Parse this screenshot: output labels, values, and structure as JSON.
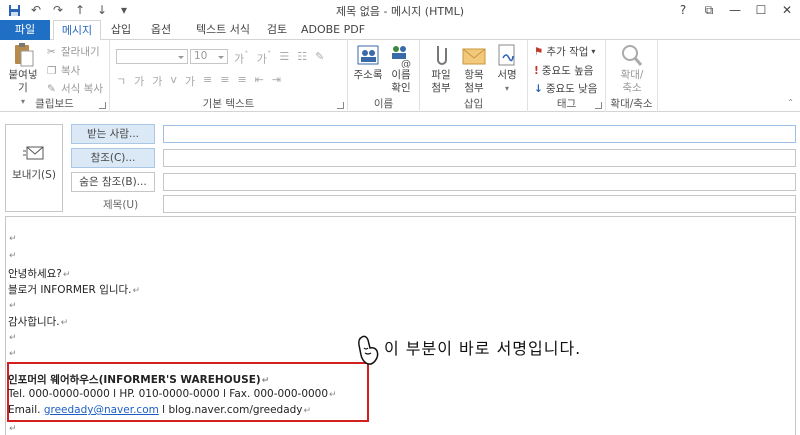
{
  "window": {
    "title": "제목 없음 - 메시지 (HTML)",
    "help": "?",
    "restore": "⧉",
    "minimize": "—",
    "maximize": "☐",
    "close": "✕"
  },
  "tabs": [
    {
      "label": "파일"
    },
    {
      "label": "메시지"
    },
    {
      "label": "삽입"
    },
    {
      "label": "옵션"
    },
    {
      "label": "텍스트 서식"
    },
    {
      "label": "검토"
    },
    {
      "label": "ADOBE PDF"
    }
  ],
  "ribbon": {
    "clipboard": {
      "label": "클립보드",
      "paste": "붙여넣기",
      "cut": "잘라내기",
      "copy": "복사",
      "format_painter": "서식 복사"
    },
    "basic_text": {
      "label": "기본 텍스트",
      "font_size": "10"
    },
    "names": {
      "label": "이름",
      "address_book": "주소록",
      "check_names_1": "이름",
      "check_names_2": "확인"
    },
    "insert": {
      "label": "삽입",
      "attach_file_1": "파일",
      "attach_file_2": "첨부",
      "attach_item_1": "항목",
      "attach_item_2": "첨부",
      "signature": "서명"
    },
    "tags": {
      "label": "태그",
      "follow_up": "추가 작업",
      "high_importance": "중요도 높음",
      "low_importance": "중요도 낮음"
    },
    "zoom": {
      "label": "확대/축소",
      "zoom_1": "확대/",
      "zoom_2": "축소"
    }
  },
  "header": {
    "send": "보내기(S)",
    "to": "받는 사람...",
    "cc": "참조(C)...",
    "bcc": "숨은 참조(B)...",
    "subject": "제목(U)"
  },
  "body": {
    "greeting": "안녕하세요?",
    "intro": "블로거 INFORMER 입니다.",
    "thanks": "감사합니다.",
    "para_mark": "↵",
    "signature": {
      "name": "인포머의 웨어하우스(INFORMER'S WAREHOUSE)",
      "phones": "Tel. 000-0000-0000   l   HP. 010-0000-0000   l   Fax. 000-000-0000",
      "email_label": "Email. ",
      "email": "greedady@naver.com",
      "sep": "   l   ",
      "blog": "blog.naver.com/greedady"
    }
  },
  "annotation": {
    "text": "이 부분이 바로 서명입니다."
  },
  "colors": {
    "accent": "#1f6fc5",
    "highlight_box": "#d22020",
    "link": "#1f5fc5"
  }
}
